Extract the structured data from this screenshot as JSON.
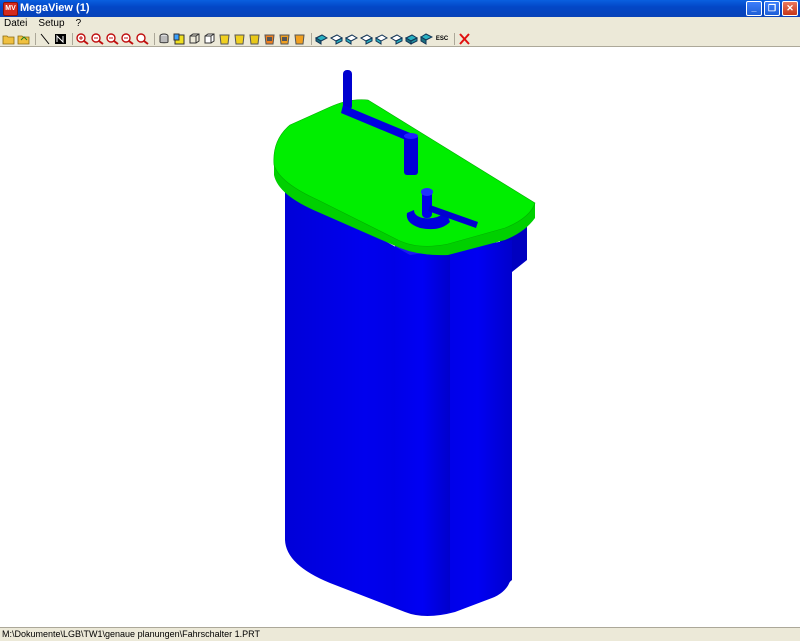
{
  "window": {
    "title": "MegaView (1)",
    "app_icon_label": "MV",
    "buttons": [
      "_",
      "❐",
      "✕"
    ]
  },
  "menu": {
    "items": [
      "Datei",
      "Setup",
      "?"
    ]
  },
  "toolbar": {
    "groups": [
      [
        "open-folder-icon",
        "save-folder-icon"
      ],
      [
        "line-tool-icon",
        "n-tool-icon"
      ],
      [
        "zoom-in-icon",
        "zoom-out-icon",
        "zoom-previous-icon",
        "zoom-window-icon",
        "zoom-all-icon"
      ],
      [
        "cylinder-view-icon",
        "shade-yellow-icon",
        "wire-box-icon",
        "hidden-line-icon",
        "yellow-cup-icon",
        "yellow-cup-2-icon",
        "yellow-cup-3-icon",
        "orange-cup-icon",
        "orange-cup-2-icon",
        "orange-cup-3-icon"
      ],
      [
        "view-iso-1-icon",
        "view-iso-2-icon",
        "view-iso-3-icon",
        "view-iso-4-icon",
        "view-iso-5-icon",
        "view-iso-6-icon",
        "view-iso-7-icon",
        "view-iso-8-icon",
        "esc-icon"
      ],
      [
        "close-red-x-icon"
      ]
    ],
    "esc_label": "ESC"
  },
  "model": {
    "body_color": "#0000ee",
    "lid_color": "#00ee00",
    "handle_color": "#0000cc"
  },
  "status": {
    "path": "M:\\Dokumente\\LGB\\TW1\\genaue planungen\\Fahrschalter 1.PRT"
  }
}
